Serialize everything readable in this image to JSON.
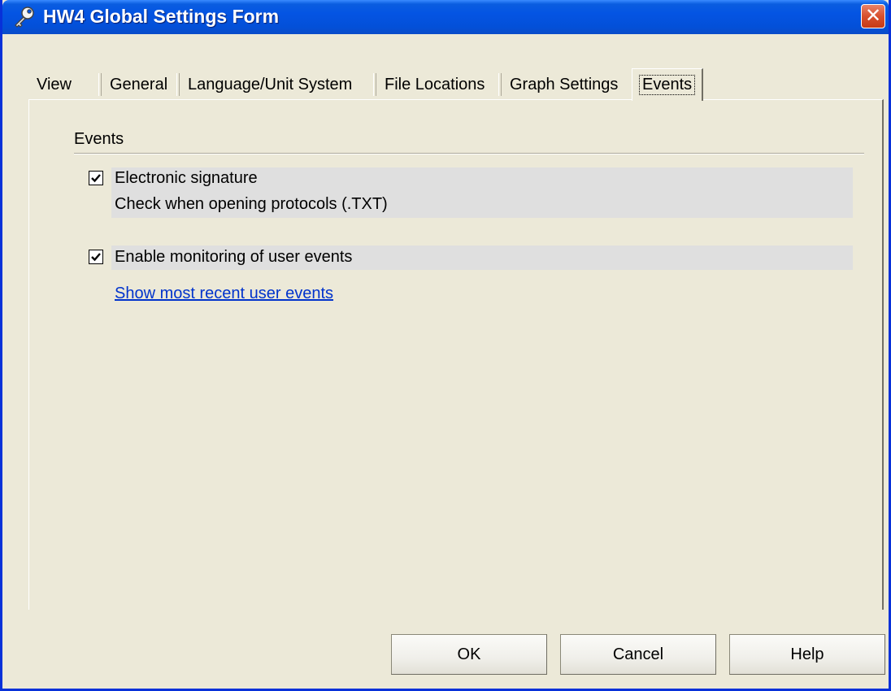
{
  "window": {
    "title": "HW4 Global Settings Form",
    "close_glyph": "✕"
  },
  "tabs": [
    {
      "label": "View",
      "active": false
    },
    {
      "label": "General",
      "active": false
    },
    {
      "label": "Language/Unit System",
      "active": false
    },
    {
      "label": "File Locations",
      "active": false
    },
    {
      "label": "Graph Settings",
      "active": false
    },
    {
      "label": "Events",
      "active": true
    }
  ],
  "events": {
    "group_label": "Events",
    "options": [
      {
        "label": "Electronic signature",
        "sublabel": "Check when opening protocols (.TXT)",
        "checked": true
      },
      {
        "label": "Enable monitoring of user events",
        "checked": true
      }
    ],
    "link": "Show most recent user events"
  },
  "buttons": {
    "ok": "OK",
    "cancel": "Cancel",
    "help": "Help"
  },
  "icons": {
    "title": "key-icon",
    "close": "close-icon",
    "check": "checkmark-icon"
  },
  "colors": {
    "titlebar": "#0454e3",
    "face": "#ece9d8",
    "link": "#0033cc"
  }
}
